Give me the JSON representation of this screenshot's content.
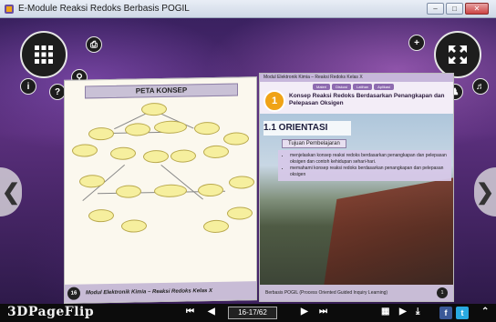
{
  "window": {
    "title": "E-Module Reaksi Redoks Berbasis POGIL"
  },
  "viewer": {
    "left_page": {
      "heading": "PETA KONSEP",
      "footer_num": "16",
      "footer_text": "Modul Elektronik Kimia – Reaksi Redoks Kelas X"
    },
    "right_page": {
      "header": "Modul Elektronik Kimia – Reaksi Redoks Kelas X",
      "tabs": [
        "Materi",
        "Diskusi",
        "Latihan",
        "Aplikasi"
      ],
      "chapter_number": "1",
      "chapter_title": "Konsep Reaksi Redoks Berdasarkan Penangkapan dan Pelepasan Oksigen",
      "section": "1.1 ORIENTASI",
      "goal_label": "Tujuan Pembelajaran",
      "goals": [
        "menjelaskan konsep reaksi redoks berdasarkan penangkapan dan pelepasan oksigen dan contoh kehidupan sehari-hari.",
        "memahami konsep reaksi redoks berdasarkan penangkapan dan pelepasan oksigen"
      ],
      "footer_text": "Berbasis POGIL (Process Oriented Guided Inquiry Learning)",
      "footer_num": "1"
    }
  },
  "toolbar": {
    "brand": "3DPageFlip",
    "page_indicator": "16-17/62"
  },
  "colors": {
    "accent": "#8e6bb0",
    "chapter": "#f0a316",
    "stage": "#5a2f7c"
  },
  "icons": [
    "grid-icon",
    "zoom-in-icon",
    "fullscreen-icon",
    "info-icon",
    "help-icon",
    "search-icon",
    "print-icon",
    "mail-icon",
    "share-icon",
    "sound-icon",
    "prev-page-icon",
    "next-page-icon",
    "first-page-icon",
    "last-page-icon",
    "thumbnails-icon",
    "play-icon",
    "download-icon",
    "facebook-icon",
    "twitter-icon",
    "expand-icon"
  ]
}
